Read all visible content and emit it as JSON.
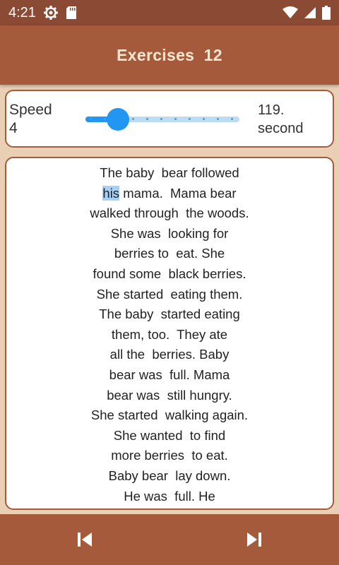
{
  "status_bar": {
    "time": "4:21",
    "icons": [
      "settings-gear-icon",
      "sd-card-icon",
      "wifi-icon",
      "signal-icon",
      "battery-icon"
    ]
  },
  "app_bar": {
    "title": "Exercises  12"
  },
  "speed": {
    "label_line1": "Speed",
    "label_line2": "4",
    "slider_position_fraction": 0.2,
    "value_line1": "119.",
    "value_line2": "second"
  },
  "reading": {
    "first_line_before": "",
    "highlighted_word": "his",
    "first_highlight_line_rest": " mama.  Mama bear",
    "lines": [
      "The baby  bear followed",
      "walked through  the woods.",
      "She was  looking for",
      "berries to  eat. She",
      "found some  black berries.",
      "She started  eating them.",
      "The baby  started eating",
      "them, too.  They ate",
      "all the  berries. Baby",
      "bear was  full. Mama",
      "bear was  still hungry.",
      "She started  walking again.",
      "She wanted  to find",
      "more berries  to eat.",
      "Baby bear  lay down.",
      "He was  full. He"
    ]
  },
  "controls": {
    "prev_icon": "skip-previous-icon",
    "next_icon": "skip-next-icon"
  },
  "colors": {
    "status_bar": "#8a4a33",
    "app_bar": "#a55a3c",
    "title_text": "#fbe6cf",
    "background": "#e9cfb4",
    "slider_accent": "#2196f3",
    "highlight": "#a8d0f5"
  }
}
